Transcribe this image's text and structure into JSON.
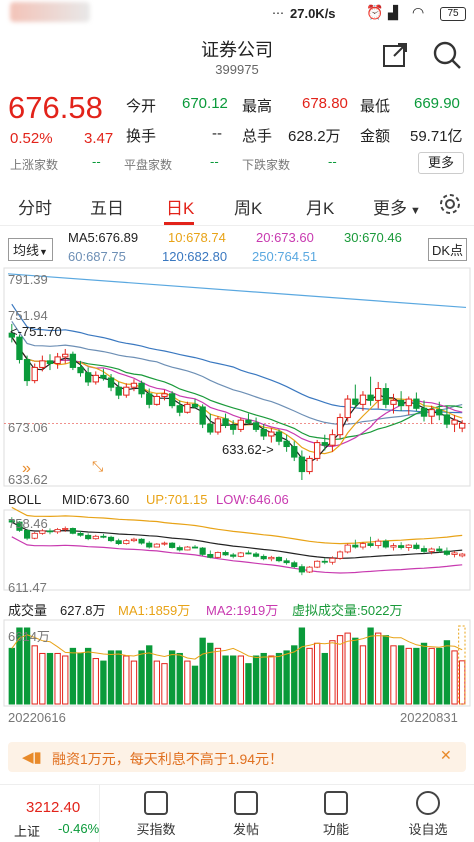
{
  "status": {
    "time_dots": "⋯",
    "speed": "27.0K/s",
    "battery": "75"
  },
  "header": {
    "title": "证券公司",
    "code": "399975"
  },
  "quote": {
    "price": "676.58",
    "pct": "0.52%",
    "change": "3.47",
    "open_label": "今开",
    "open": "670.12",
    "high_label": "最高",
    "high": "678.80",
    "low_label": "最低",
    "low": "669.90",
    "turnover_label": "换手",
    "turnover": "--",
    "vol_label": "总手",
    "vol": "628.2万",
    "amount_label": "金额",
    "amount": "59.71亿",
    "up_label": "上涨家数",
    "up": "--",
    "flat_label": "平盘家数",
    "flat": "--",
    "down_label": "下跌家数",
    "down": "--",
    "more": "更多"
  },
  "tabs": [
    "分时",
    "五日",
    "日K",
    "周K",
    "月K",
    "更多"
  ],
  "active_tab": 2,
  "ma": {
    "type": "均线",
    "ma5": "MA5:676.89",
    "ma10": "10:678.74",
    "ma20": "20:673.60",
    "ma30": "30:670.46",
    "ma60": "60:687.75",
    "ma120": "120:682.80",
    "ma250": "250:764.51",
    "dk": "DK点"
  },
  "kline": {
    "y_top": "791.39",
    "y_2": "751.94",
    "y_3": "673.06",
    "y_bot": "633.62",
    "max_annot": "<-751.70",
    "min_annot": "633.62->"
  },
  "boll": {
    "title": "BOLL",
    "mid": "MID:673.60",
    "up": "UP:701.15",
    "low": "LOW:646.06",
    "y_top": "758.46",
    "y_bot": "611.47"
  },
  "volume": {
    "title": "成交量",
    "value": "627.8万",
    "ma1": "MA1:1859万",
    "ma2": "MA2:1919万",
    "virtual": "虚拟成交量:5022万",
    "y_top": "6614万",
    "date_start": "20220616",
    "date_end": "20220831"
  },
  "banner": {
    "text": "融资1万元，每天利息不高于1.94元！"
  },
  "bottom": {
    "index_value": "3212.40",
    "index_name": "上证",
    "index_pct": "-0.46%",
    "items": [
      "买指数",
      "发帖",
      "功能",
      "设自选"
    ]
  },
  "colors": {
    "up": "#e2231a",
    "down": "#0a9a3a",
    "ma5": "#222",
    "ma10": "#e8a317",
    "ma20": "#c83ab0",
    "ma30": "#1a9a3a",
    "ma60": "#6d8fb5",
    "ma120": "#3a78c0",
    "ma250": "#5aa8e0"
  },
  "chart_data": {
    "type": "candlestick",
    "candles": [
      [
        745,
        752,
        738,
        742
      ],
      [
        742,
        744,
        722,
        725
      ],
      [
        725,
        728,
        705,
        709
      ],
      [
        709,
        722,
        707,
        719
      ],
      [
        719,
        728,
        716,
        724
      ],
      [
        724,
        729,
        717,
        722
      ],
      [
        722,
        730,
        718,
        727
      ],
      [
        727,
        733,
        722,
        729
      ],
      [
        729,
        731,
        717,
        719
      ],
      [
        719,
        724,
        712,
        715
      ],
      [
        715,
        719,
        705,
        708
      ],
      [
        708,
        716,
        706,
        713
      ],
      [
        713,
        718,
        709,
        711
      ],
      [
        711,
        714,
        701,
        704
      ],
      [
        704,
        708,
        695,
        698
      ],
      [
        698,
        707,
        696,
        704
      ],
      [
        704,
        710,
        701,
        707
      ],
      [
        707,
        709,
        696,
        699
      ],
      [
        699,
        703,
        688,
        691
      ],
      [
        691,
        699,
        690,
        697
      ],
      [
        697,
        702,
        694,
        699
      ],
      [
        699,
        701,
        688,
        690
      ],
      [
        690,
        694,
        682,
        685
      ],
      [
        685,
        693,
        684,
        691
      ],
      [
        691,
        695,
        688,
        689
      ],
      [
        689,
        691,
        673,
        676
      ],
      [
        676,
        684,
        668,
        670
      ],
      [
        670,
        682,
        668,
        680
      ],
      [
        680,
        684,
        673,
        675
      ],
      [
        675,
        679,
        668,
        672
      ],
      [
        672,
        681,
        670,
        679
      ],
      [
        679,
        684,
        676,
        677
      ],
      [
        677,
        681,
        670,
        672
      ],
      [
        672,
        676,
        664,
        667
      ],
      [
        667,
        673,
        662,
        670
      ],
      [
        670,
        672,
        660,
        663
      ],
      [
        663,
        668,
        655,
        659
      ],
      [
        659,
        663,
        648,
        651
      ],
      [
        651,
        656,
        633.62,
        640
      ],
      [
        640,
        652,
        638,
        650
      ],
      [
        650,
        664,
        648,
        662
      ],
      [
        662,
        668,
        656,
        660
      ],
      [
        660,
        672,
        655,
        668
      ],
      [
        668,
        684,
        665,
        681
      ],
      [
        681,
        698,
        678,
        695
      ],
      [
        695,
        706,
        688,
        691
      ],
      [
        691,
        701,
        686,
        698
      ],
      [
        698,
        712,
        690,
        694
      ],
      [
        694,
        708,
        688,
        703
      ],
      [
        703,
        707,
        688,
        691
      ],
      [
        691,
        699,
        684,
        694
      ],
      [
        694,
        701,
        686,
        690
      ],
      [
        690,
        697,
        683,
        695
      ],
      [
        695,
        700,
        686,
        688
      ],
      [
        688,
        694,
        678,
        682
      ],
      [
        682,
        690,
        676,
        687
      ],
      [
        687,
        693,
        679,
        683
      ],
      [
        683,
        690,
        673,
        676
      ],
      [
        676,
        683,
        670,
        679
      ],
      [
        673,
        679,
        669.9,
        676.58
      ]
    ]
  }
}
